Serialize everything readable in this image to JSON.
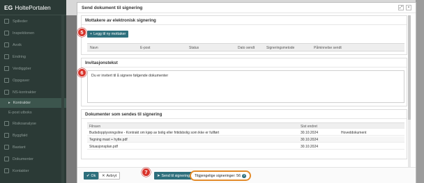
{
  "app": {
    "brand_prefix": "EG",
    "brand_name": "HolteP​ortalen"
  },
  "sidebar": {
    "items": [
      {
        "label": "Spilleder"
      },
      {
        "label": "Inspektionen"
      },
      {
        "label": "Avvik"
      },
      {
        "label": "Endring"
      },
      {
        "label": "Verdiggöer"
      },
      {
        "label": "Oppgaver"
      },
      {
        "label": "NS-kontrakter"
      },
      {
        "label": "Kontrakter"
      },
      {
        "label": "E-post utboks"
      },
      {
        "label": "Risikoanalyse"
      },
      {
        "label": "Byggfakt"
      },
      {
        "label": "Bastant"
      },
      {
        "label": "Dokumenter"
      },
      {
        "label": "Kontakter"
      }
    ]
  },
  "modal": {
    "title": "Send dokument til signering",
    "recipients": {
      "heading": "Mottakere av elektronisk signering",
      "add_button": "Legg til ny mottaker",
      "columns": [
        "Navn",
        "E-post",
        "Status",
        "Dato sendt",
        "Signeringsmetode",
        "Påminnelse sendt"
      ]
    },
    "invitation": {
      "heading": "Invitasjonstekst",
      "text": "Du er invitert til å signere følgende dokumenter"
    },
    "documents": {
      "heading": "Dokumenter som sendes til signering",
      "columns": [
        "Filnavn",
        "Sist endret"
      ],
      "rows": [
        {
          "name": "Budsdopplysningsline - Kontrakt om kjøp av bolig eller fritidsbolig som ikke er fullført",
          "date": "30.10.2024",
          "tag": "Hoveddokument"
        },
        {
          "name": "Tegning mast + hytte.pdf",
          "date": "30.10.2024",
          "tag": ""
        },
        {
          "name": "Situasjonsplan.pdf",
          "date": "30.10.2024",
          "tag": ""
        }
      ]
    },
    "footer": {
      "ok_label": "Ok",
      "cancel_label": "Avbryt",
      "send_label": "Send til signering",
      "remaining_label": "Tilgjengelige signeringer: 56"
    }
  },
  "steps": {
    "s5": "5",
    "s6": "6",
    "s7": "7"
  },
  "colors": {
    "accent": "#2e6f7c",
    "step_badge": "#d9342b",
    "highlight_ring": "#e38b2a"
  }
}
